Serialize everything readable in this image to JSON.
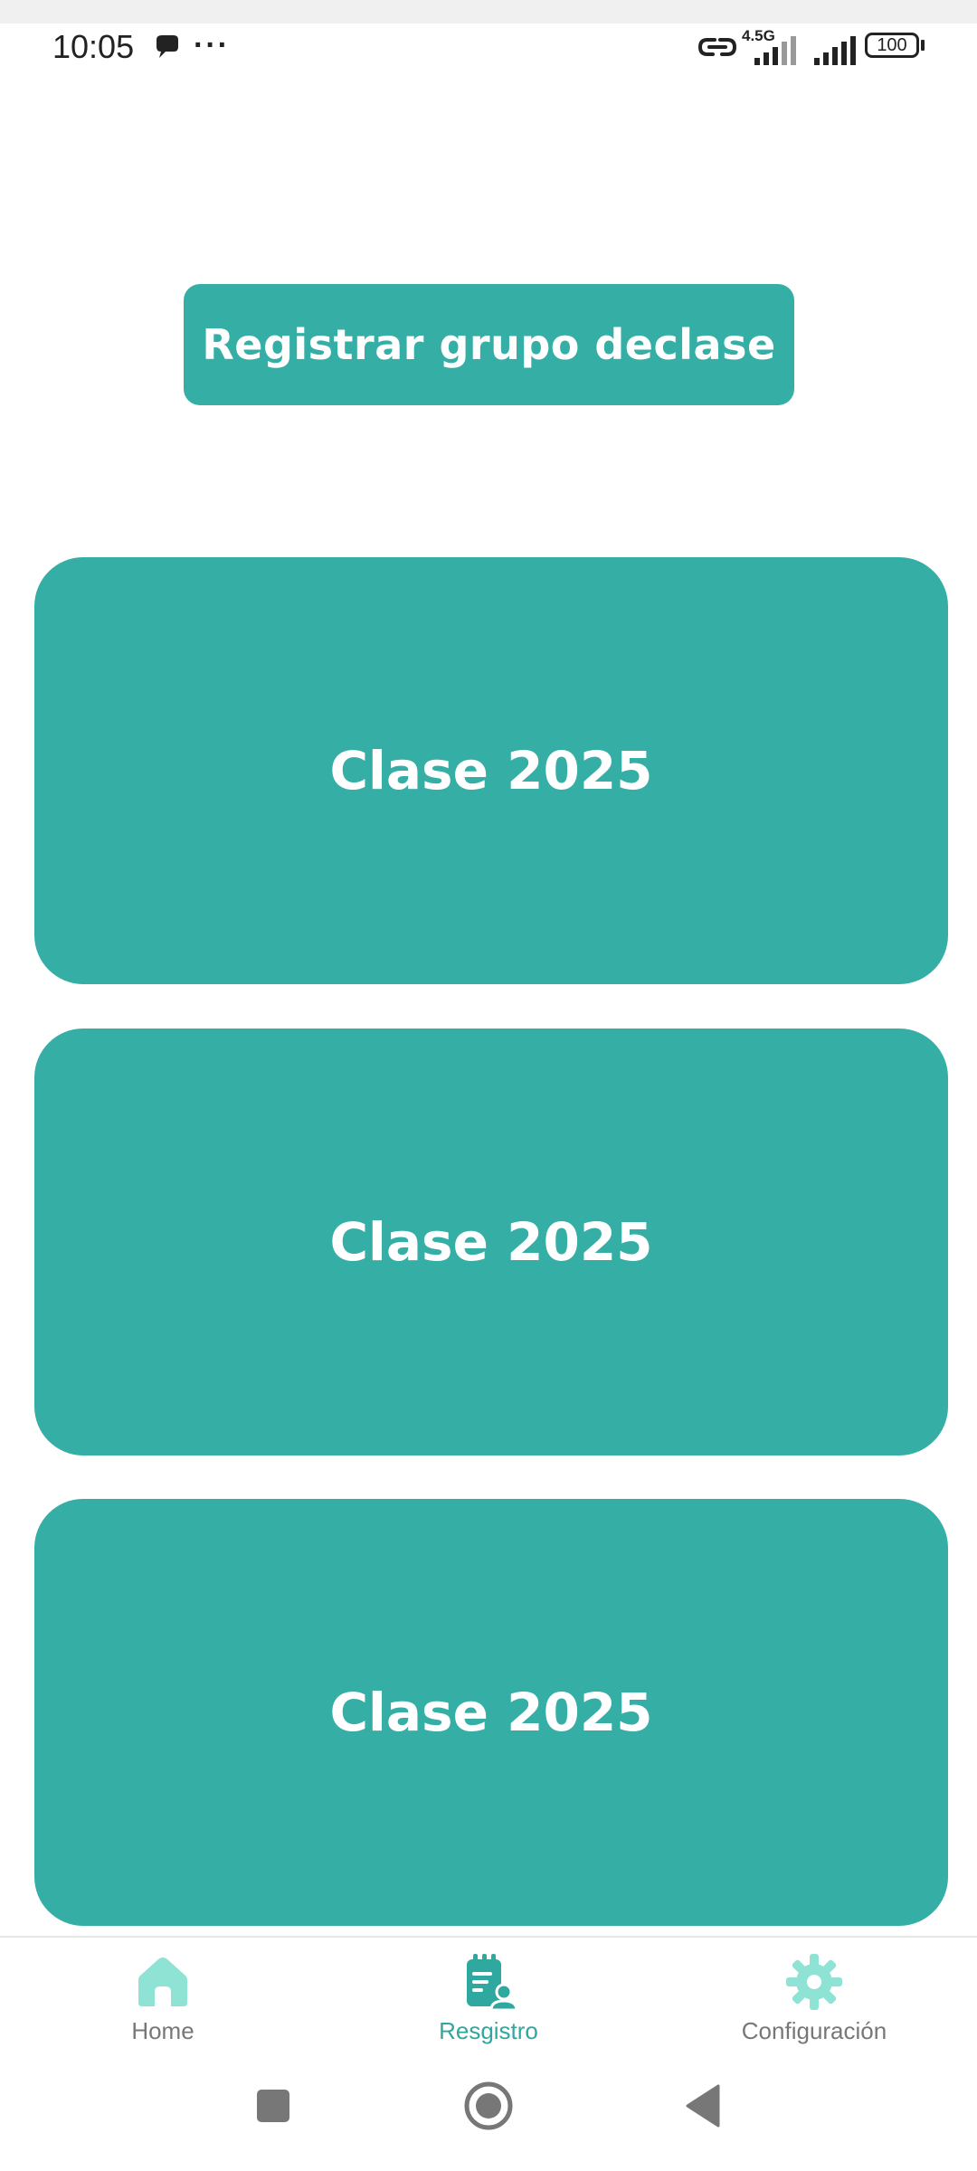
{
  "status_bar": {
    "time": "10:05",
    "more": "···",
    "network": "4.5G",
    "battery": "100"
  },
  "register_button": {
    "label": "Registrar grupo declase"
  },
  "classes": [
    {
      "label": "Clase 2025"
    },
    {
      "label": "Clase 2025"
    },
    {
      "label": "Clase 2025"
    }
  ],
  "bottom_nav": {
    "items": [
      {
        "label": "Home",
        "icon": "home-icon",
        "active": false
      },
      {
        "label": "Resgistro",
        "icon": "register-icon",
        "active": true
      },
      {
        "label": "Configuración",
        "icon": "gear-icon",
        "active": false
      }
    ]
  },
  "colors": {
    "primary": "#35afa6",
    "nav_active": "#2fa89f",
    "nav_icon_light": "#8fe3d4",
    "nav_inactive": "#777777"
  }
}
